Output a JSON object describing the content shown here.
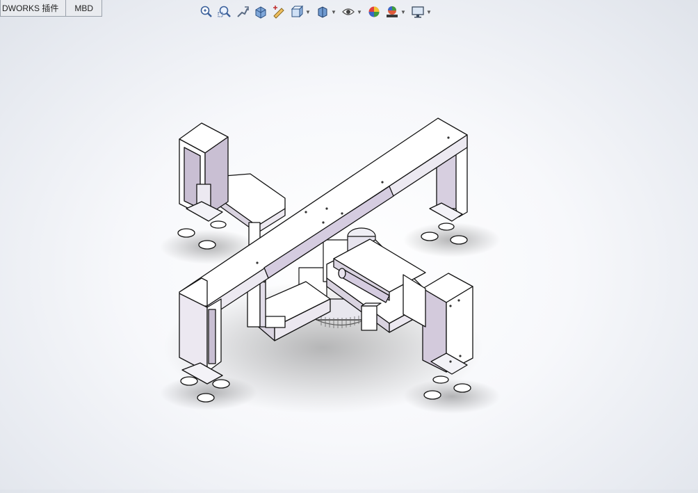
{
  "tabs": [
    {
      "label": "DWORKS 插件"
    },
    {
      "label": "MBD"
    }
  ],
  "heads_up_toolbar": {
    "buttons": [
      {
        "icon": "zoom-to-fit-icon",
        "dropdown": false
      },
      {
        "icon": "zoom-to-area-icon",
        "dropdown": false
      },
      {
        "icon": "previous-view-icon",
        "dropdown": false
      },
      {
        "icon": "section-view-icon",
        "dropdown": false
      },
      {
        "icon": "dynamic-annotation-icon",
        "dropdown": false
      },
      {
        "icon": "view-orientation-icon",
        "dropdown": true
      },
      {
        "icon": "display-style-icon",
        "dropdown": true
      },
      {
        "icon": "hide-show-items-icon",
        "dropdown": true
      },
      {
        "icon": "edit-appearance-icon",
        "dropdown": false
      },
      {
        "icon": "apply-scene-icon",
        "dropdown": true
      },
      {
        "icon": "view-settings-icon",
        "dropdown": true
      }
    ]
  },
  "colors": {
    "part_face_light": "#ffffff",
    "part_face_mid": "#efeef5",
    "part_face_dark": "#c9c0d4",
    "edge": "#111111",
    "background_edge": "#dfe3ea"
  },
  "model": {
    "description_visible": false
  }
}
